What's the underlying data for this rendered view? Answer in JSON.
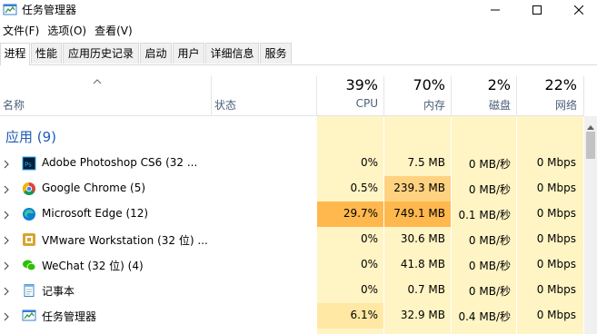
{
  "window": {
    "title": "任务管理器",
    "controls": {
      "minimize": "minimize",
      "maximize": "maximize",
      "close": "close"
    }
  },
  "menu": [
    {
      "label": "文件(F)"
    },
    {
      "label": "选项(O)"
    },
    {
      "label": "查看(V)"
    }
  ],
  "tabs": [
    {
      "label": "进程",
      "active": true
    },
    {
      "label": "性能"
    },
    {
      "label": "应用历史记录"
    },
    {
      "label": "启动"
    },
    {
      "label": "用户"
    },
    {
      "label": "详细信息"
    },
    {
      "label": "服务"
    }
  ],
  "columns": {
    "name": "名称",
    "status": "状态",
    "cpu": {
      "percent": "39%",
      "label": "CPU"
    },
    "memory": {
      "percent": "70%",
      "label": "内存"
    },
    "disk": {
      "percent": "2%",
      "label": "磁盘"
    },
    "network": {
      "percent": "22%",
      "label": "网络"
    }
  },
  "group": {
    "title": "应用 (9)"
  },
  "processes": [
    {
      "name": "Adobe Photoshop CS6 (32 ...",
      "icon": "photoshop-icon",
      "cpu": "0%",
      "memory": "7.5 MB",
      "disk": "0 MB/秒",
      "network": "0 Mbps"
    },
    {
      "name": "Google Chrome (5)",
      "icon": "chrome-icon",
      "cpu": "0.5%",
      "memory": "239.3 MB",
      "disk": "0 MB/秒",
      "network": "0 Mbps"
    },
    {
      "name": "Microsoft Edge (12)",
      "icon": "edge-icon",
      "cpu": "29.7%",
      "memory": "749.1 MB",
      "disk": "0.1 MB/秒",
      "network": "0 Mbps"
    },
    {
      "name": "VMware Workstation (32 位) ...",
      "icon": "vmware-icon",
      "cpu": "0%",
      "memory": "30.6 MB",
      "disk": "0 MB/秒",
      "network": "0 Mbps"
    },
    {
      "name": "WeChat (32 位) (4)",
      "icon": "wechat-icon",
      "cpu": "0%",
      "memory": "41.8 MB",
      "disk": "0 MB/秒",
      "network": "0 Mbps"
    },
    {
      "name": "记事本",
      "icon": "notepad-icon",
      "cpu": "0%",
      "memory": "0.7 MB",
      "disk": "0 MB/秒",
      "network": "0 Mbps"
    },
    {
      "name": "任务管理器",
      "icon": "task-manager-icon",
      "cpu": "6.1%",
      "memory": "32.9 MB",
      "disk": "0.4 MB/秒",
      "network": "0 Mbps"
    }
  ],
  "colors": {
    "heat_light": "#fff4c4",
    "heat_medium": "#ffe8a3",
    "heat_high": "#ffd280",
    "heat_hot": "#ffb84d",
    "group_title": "#1f5bb5",
    "header_label": "#4c607a"
  }
}
